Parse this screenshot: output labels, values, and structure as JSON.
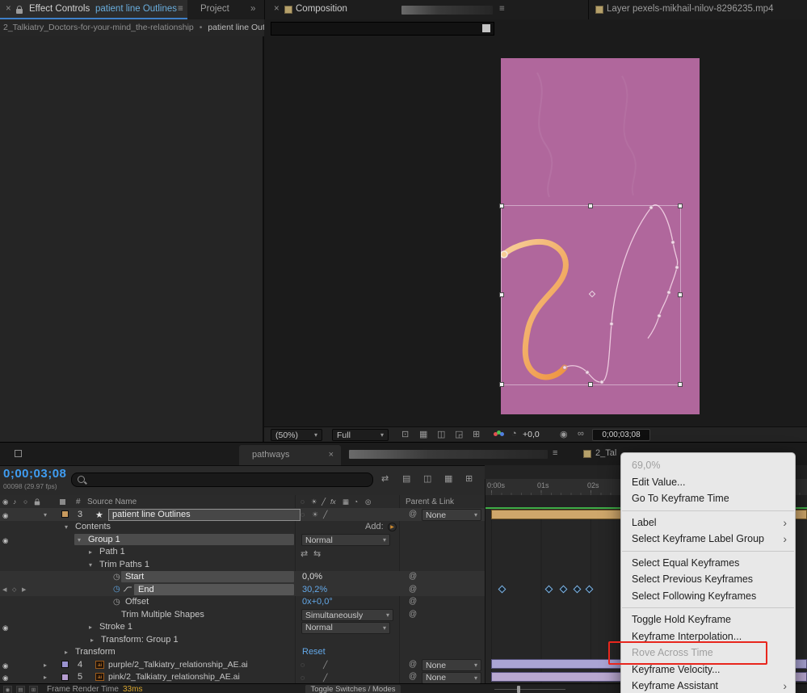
{
  "colors": {
    "accent_blue": "#3f9df2",
    "value_blue": "#63a8e8",
    "comp_pink": "#b0679c",
    "stroke_orange": "#ee9440",
    "layer_bar_tan": "#cfa76b",
    "layer_bar_lavender": "#aaa4d4",
    "cache_green": "#3fae46",
    "annotation_red": "#e8261d",
    "render_ms_yellow": "#d9a62d"
  },
  "icons": {
    "close": "×",
    "menu": "≡",
    "overflow": "»",
    "twirl_open": "▾",
    "twirl_closed": "▸",
    "star": "★",
    "eye": "◉",
    "audio": "♪",
    "solo": "○",
    "stopwatch": "◷",
    "kf_prev": "◀",
    "kf_add": "◇",
    "kf_next": "▶",
    "dropdown_arrow": "▾",
    "submenu_arrow": "›",
    "pick_whip": "@",
    "add_button": "▶",
    "layer_switches": [
      "◌",
      "☀",
      "╱"
    ],
    "header_switches": [
      "◌",
      "☀",
      "╱",
      "fx",
      "▦",
      "◔",
      "◎"
    ],
    "path_direction": [
      "⇄",
      "⇆"
    ],
    "viewer_tools": [
      "⊡",
      "▦",
      "◫",
      "◲",
      "⊞"
    ],
    "tl_tools": [
      "⇄",
      "▤",
      "◫",
      "▦",
      "⊞"
    ],
    "exposure": "◔",
    "camera": "◉",
    "stereo": "∞",
    "bottom_buttons": [
      "◉",
      "▤",
      "⊞"
    ]
  },
  "top": {
    "effect_controls": {
      "title": "Effect Controls",
      "layer_name": "patient line Outlines",
      "project_tab": "Project",
      "breadcrumb_comp": "2_Talkiatry_Doctors-for-your-mind_the-relationship",
      "breadcrumb_sep": "•",
      "breadcrumb_layer": "patient line Outlin"
    },
    "composition": {
      "title": "Composition"
    },
    "layer": {
      "title": "Layer pexels-mikhail-nilov-8296235.mp4"
    }
  },
  "viewer": {
    "zoom": "(50%)",
    "resolution": "Full",
    "exposure": "+0,0",
    "timecode": "0;00;03;08"
  },
  "timeline": {
    "tab_pathways": "pathways",
    "tab_current": "2_Tal",
    "timecode": "0;00;03;08",
    "frame_info": "00098 (29.97 fps)",
    "ruler_labels": [
      "0:00s",
      "01s",
      "02s"
    ],
    "headers": {
      "hash": "#",
      "source_name": "Source Name",
      "parent_link": "Parent & Link"
    },
    "rows": {
      "layer3": {
        "num": "3",
        "name": "patient line Outlines",
        "parent": "None"
      },
      "contents": {
        "label": "Contents",
        "add_label": "Add:"
      },
      "group1": {
        "label": "Group 1",
        "blend": "Normal"
      },
      "path1": {
        "label": "Path 1"
      },
      "trim_paths": {
        "label": "Trim Paths 1"
      },
      "start": {
        "label": "Start",
        "value": "0,0%"
      },
      "end": {
        "label": "End",
        "value": "30,2%"
      },
      "offset": {
        "label": "Offset",
        "value": "0x+0,0°"
      },
      "trim_multiple": {
        "label": "Trim Multiple Shapes",
        "value": "Simultaneously"
      },
      "stroke1": {
        "label": "Stroke 1",
        "blend": "Normal"
      },
      "transform_group": {
        "label": "Transform: Group 1"
      },
      "transform": {
        "label": "Transform",
        "reset": "Reset"
      },
      "layer4": {
        "num": "4",
        "name": "purple/2_Talkiatry_relationship_AE.ai",
        "parent": "None"
      },
      "layer5": {
        "num": "5",
        "name": "pink/2_Talkiatry_relationship_AE.ai",
        "parent": "None"
      }
    },
    "bottom": {
      "render_label": "Frame Render Time",
      "render_value": "33ms",
      "toggle_label": "Toggle Switches / Modes"
    }
  },
  "context_menu": {
    "items": [
      {
        "label": "69,0%",
        "disabled": true
      },
      {
        "label": "Edit Value..."
      },
      {
        "label": "Go To Keyframe Time"
      },
      {
        "separator": true
      },
      {
        "label": "Label",
        "submenu": true
      },
      {
        "label": "Select Keyframe Label Group",
        "submenu": true
      },
      {
        "separator": true
      },
      {
        "label": "Select Equal Keyframes"
      },
      {
        "label": "Select Previous Keyframes"
      },
      {
        "label": "Select Following Keyframes"
      },
      {
        "separator": true
      },
      {
        "label": "Toggle Hold Keyframe"
      },
      {
        "label": "Keyframe Interpolation..."
      },
      {
        "label": "Rove Across Time",
        "disabled": true,
        "annotated": true
      },
      {
        "label": "Keyframe Velocity..."
      },
      {
        "label": "Keyframe Assistant",
        "submenu": true
      }
    ]
  }
}
